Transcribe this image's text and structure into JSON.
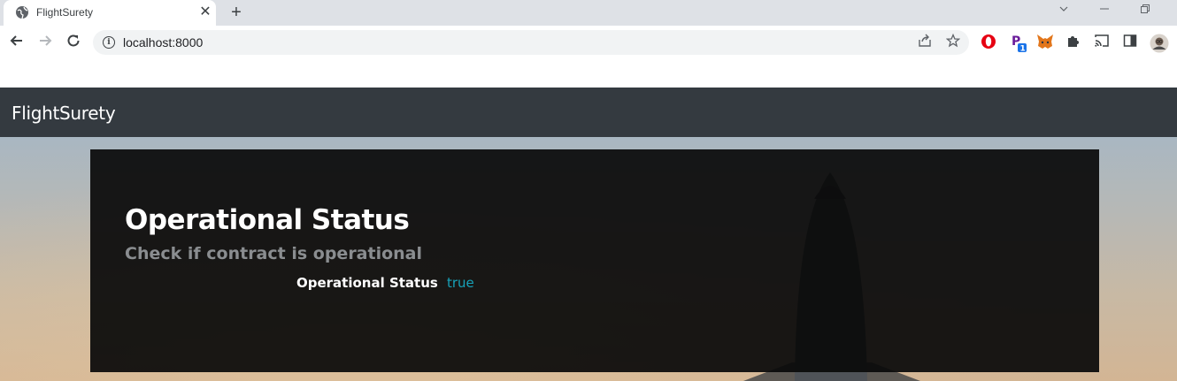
{
  "browser": {
    "tab": {
      "title": "FlightSurety",
      "favicon": "globe-icon"
    },
    "new_tab_label": "+",
    "url": "localhost:8000",
    "extensions": [
      "opera-icon",
      "extension-p-icon",
      "metamask-icon",
      "puzzle-icon",
      "cast-icon",
      "side-panel-icon",
      "profile-avatar"
    ],
    "extension_badge": "1"
  },
  "navbar": {
    "brand": "FlightSurety"
  },
  "panel": {
    "title": "Operational Status",
    "subtitle": "Check if contract is operational",
    "status_label": "Operational Status",
    "status_value": "true"
  },
  "colors": {
    "navbar_bg": "#343a40",
    "status_value": "#17a2b8"
  }
}
